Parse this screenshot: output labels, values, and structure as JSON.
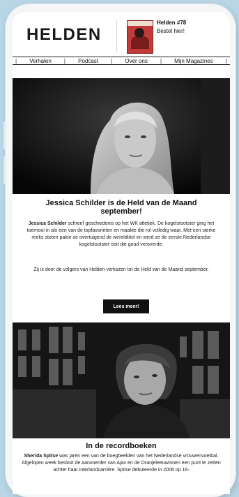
{
  "header": {
    "logo": "HELDEN",
    "magazine": {
      "title": "Helden #78",
      "cta": "Bestel hier!"
    }
  },
  "nav": {
    "items": [
      "Verhalen",
      "Podcast",
      "Over ons",
      "Mijn Magazines"
    ]
  },
  "article1": {
    "title_line1": "Jessica Schilder is de Held van de Maand",
    "title_line2": "september!",
    "lead_name": "Jessica Schilder",
    "lead_rest": " schreef geschiedenis op het WK atletiek. De kogelstootster ging het toernooi in als een van de topfavorieten en maakte die rol volledig waar. Met een sterke reeks stoten pakte ze overtuigend de wereldtitel en werd ze de eerste Nederlandse kogelstootster ooit die goud veroverde.",
    "body2": "Zij is door de volgers van Helden verkozen tot de Held van de Maand september.",
    "button": "Lees meer!"
  },
  "article2": {
    "title": "In de recordboeken",
    "lead_name": "Sherida Spitse",
    "lead_rest": " was jaren een van de boegbeelden van het Nederlandse vrouwenvoetbal. Afgelopen week besloot de aanvoerder van Ajax en de Oranjeleeuwinnen een punt te zetten achter haar interlandcarrière. Spitse debuteerde in 2006 op 16-"
  },
  "colors": {
    "background": "#b9d6e6",
    "button": "#111111",
    "text": "#111111"
  }
}
